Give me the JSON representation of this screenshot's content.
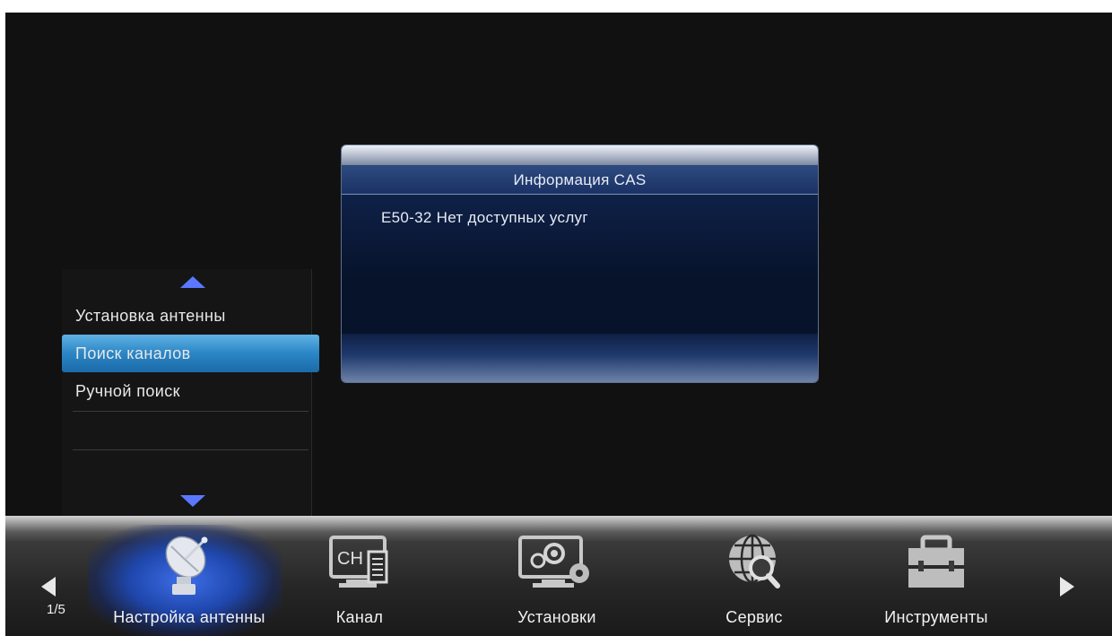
{
  "dialog": {
    "title": "Информация CAS",
    "message": "E50-32 Нет доступных услуг"
  },
  "submenu": {
    "items": [
      {
        "label": "Установка антенны",
        "selected": false
      },
      {
        "label": "Поиск каналов",
        "selected": true
      },
      {
        "label": "Ручной поиск",
        "selected": false
      }
    ]
  },
  "bottombar": {
    "page_indicator": "1/5",
    "tabs": [
      {
        "label": "Настройка антенны",
        "icon": "satellite-dish-icon",
        "active": true
      },
      {
        "label": "Канал",
        "icon": "channel-list-icon",
        "active": false
      },
      {
        "label": "Установки",
        "icon": "settings-monitor-icon",
        "active": false
      },
      {
        "label": "Сервис",
        "icon": "globe-search-icon",
        "active": false
      },
      {
        "label": "Инструменты",
        "icon": "toolbox-icon",
        "active": false
      }
    ]
  },
  "colors": {
    "selection": "#2b86c5",
    "scroll_arrow": "#5a78ff",
    "dialog_bg": "#0a1731",
    "active_glow": "#3e6ee8"
  }
}
